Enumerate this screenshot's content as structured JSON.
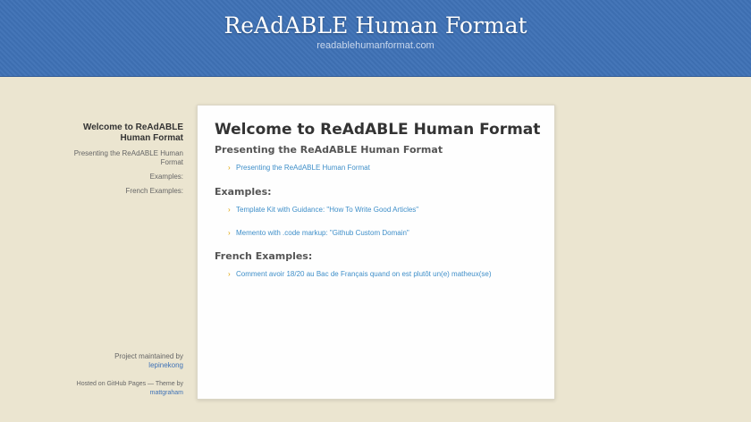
{
  "header": {
    "title": "ReAdABLE Human Format",
    "url": "readablehumanformat.com"
  },
  "sidebar": {
    "current": "Welcome to ReAdABLE Human Format",
    "items": [
      {
        "label": "Presenting the ReAdABLE Human Format"
      },
      {
        "label": "Examples:"
      },
      {
        "label": "French Examples:"
      }
    ],
    "footer": {
      "maintained_prefix": "Project maintained by",
      "maintainer": "lepinekong",
      "hosted_text": "Hosted on GitHub Pages — Theme by",
      "theme_author": "mattgraham"
    }
  },
  "content": {
    "title": "Welcome to ReAdABLE Human Format",
    "sections": [
      {
        "heading": "Presenting the ReAdABLE Human Format",
        "links": [
          "Presenting the ReAdABLE Human Format"
        ]
      },
      {
        "heading": "Examples:",
        "links": [
          "Template Kit with Guidance: \"How To Write Good Articles\"",
          "Memento with .code markup: \"Github Custom Domain\""
        ]
      },
      {
        "heading": "French Examples:",
        "links": [
          "Comment avoir 18/20 au Bac de Français quand on est plutôt un(e) matheux(se)"
        ]
      }
    ]
  },
  "colors": {
    "header_bg": "#3f72b6",
    "page_bg": "#ebe5d0",
    "link": "#3f8fc9",
    "bullet": "#e0a300"
  },
  "icons": {
    "bullet": "chevron-right-icon"
  }
}
